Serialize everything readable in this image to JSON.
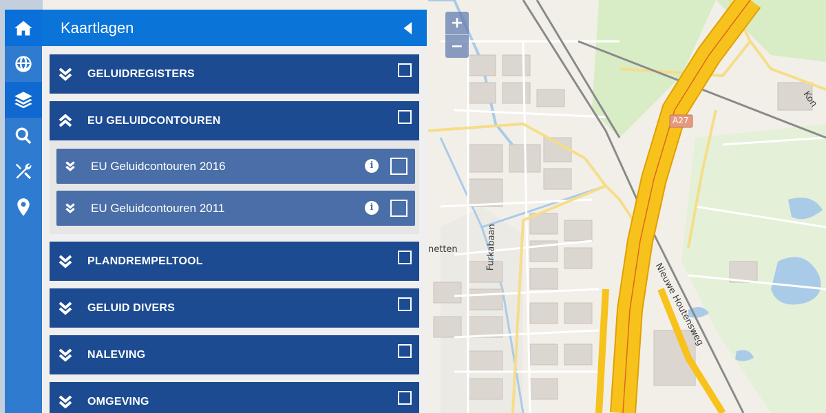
{
  "toolbar": {
    "items": [
      {
        "name": "home-icon"
      },
      {
        "name": "globe-icon"
      },
      {
        "name": "layers-icon"
      },
      {
        "name": "search-icon"
      },
      {
        "name": "tools-icon"
      },
      {
        "name": "map-marker-icon"
      }
    ],
    "active_item": "layers-icon"
  },
  "panel": {
    "title": "Kaartlagen",
    "groups": [
      {
        "label": "GELUIDREGISTERS",
        "expanded": false,
        "checked": false
      },
      {
        "label": "EU GELUIDCONTOUREN",
        "expanded": true,
        "checked": false,
        "children": [
          {
            "label": "EU Geluidcontouren 2016",
            "checked": false
          },
          {
            "label": "EU Geluidcontouren 2011",
            "checked": false
          }
        ]
      },
      {
        "label": "PLANDREMPELTOOL",
        "expanded": false,
        "checked": false
      },
      {
        "label": "GELUID DIVERS",
        "expanded": false,
        "checked": false
      },
      {
        "label": "NALEVING",
        "expanded": false,
        "checked": false
      },
      {
        "label": "OMGEVING",
        "expanded": false,
        "checked": false
      }
    ],
    "info_symbol": "i"
  },
  "map": {
    "zoom_in": "+",
    "zoom_out": "−",
    "labels": {
      "road_shield": "A27",
      "street_1": "Furkabaan",
      "street_2": "Nieuwe Houtensweg",
      "place_fragment": "netten",
      "edge_fragment": "Kon"
    }
  },
  "colors": {
    "header_blue": "#0a74d9",
    "group_blue": "#1c4b91",
    "sub_blue": "#4a6fa8",
    "toolbar_blue": "#2f7bd0",
    "motorway": "#f7c21c"
  }
}
